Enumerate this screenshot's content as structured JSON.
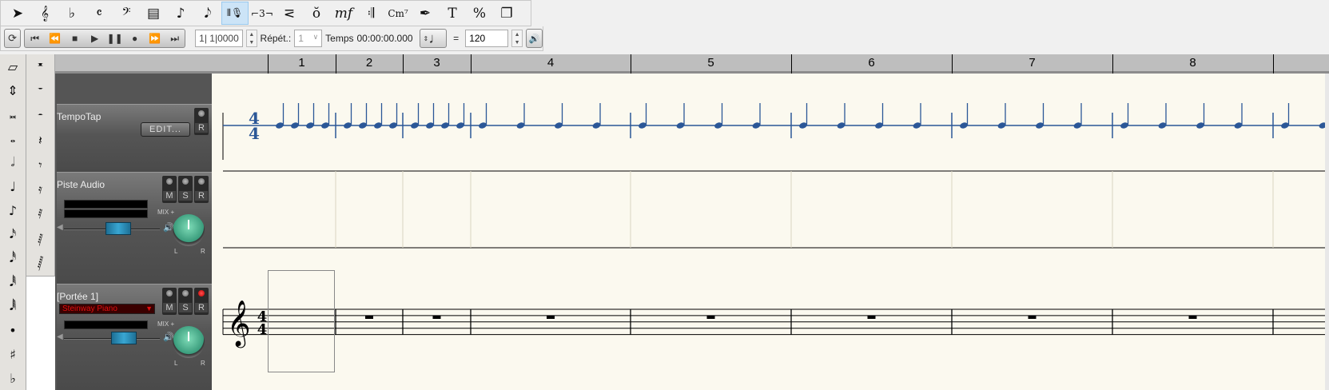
{
  "toolbar1": {
    "tools": [
      {
        "name": "select-arrow",
        "glyph": "➤"
      },
      {
        "name": "treble-staff",
        "glyph": "𝄞"
      },
      {
        "name": "key-signature",
        "glyph": "♭"
      },
      {
        "name": "time-signature",
        "glyph": "𝄴"
      },
      {
        "name": "bass-clef",
        "glyph": "𝄢"
      },
      {
        "name": "staff-box",
        "glyph": "▤"
      },
      {
        "name": "eighth-note",
        "glyph": "♪"
      },
      {
        "name": "grace-note",
        "glyph": "𝅘𝅥𝅮"
      },
      {
        "name": "mic-tracker",
        "glyph": "⦀🎙",
        "active": true
      },
      {
        "name": "tuplet",
        "glyph": "⌐3¬"
      },
      {
        "name": "hairpin",
        "glyph": "⋜"
      },
      {
        "name": "accent-note",
        "glyph": "ŏ"
      },
      {
        "name": "dynamics",
        "glyph": "mf"
      },
      {
        "name": "repeat-barline",
        "glyph": "𝄇"
      },
      {
        "name": "chord-symbol",
        "glyph": "Cm⁷"
      },
      {
        "name": "ink-pen",
        "glyph": "✒"
      },
      {
        "name": "text",
        "glyph": "T"
      },
      {
        "name": "percent",
        "glyph": "%"
      },
      {
        "name": "pages",
        "glyph": "❐"
      }
    ]
  },
  "toolbar2": {
    "loop_glyph": "⟳",
    "transport": [
      {
        "name": "go-start",
        "glyph": "⏮"
      },
      {
        "name": "rewind",
        "glyph": "⏪"
      },
      {
        "name": "stop",
        "glyph": "■"
      },
      {
        "name": "play",
        "glyph": "▶"
      },
      {
        "name": "pause",
        "glyph": "❚❚"
      },
      {
        "name": "record",
        "glyph": "●"
      },
      {
        "name": "fast-forward",
        "glyph": "⏩"
      },
      {
        "name": "go-end",
        "glyph": "⏭"
      }
    ],
    "position": "1| 1|0000",
    "repeat_label": "Répét.:",
    "repeat_value": "1",
    "time_label": "Temps",
    "time_value": "00:00:00.000",
    "note_glyph": "♩",
    "equals": "=",
    "tempo": "120",
    "metronome_glyph": "🔊"
  },
  "palette_notes": [
    "▱",
    "⇕",
    "𝅜",
    "𝅝",
    "𝅗𝅥",
    "♩",
    "♪",
    "𝅘𝅥𝅯",
    "𝅘𝅥𝅰",
    "𝅘𝅥𝅱",
    "𝅘𝅥𝅲",
    "•",
    "♯",
    "♭"
  ],
  "palette_rests": [
    "𝄺",
    "𝄻",
    "𝄼",
    "𝄽",
    "𝄾",
    "𝄿",
    "𝅀",
    "𝅁",
    "𝅂"
  ],
  "ruler": {
    "measures": [
      "1",
      "2",
      "3",
      "4",
      "5",
      "6",
      "7",
      "8"
    ]
  },
  "tracks": {
    "tempo": {
      "name": "TempoTap",
      "edit": "EDIT...",
      "r": "R"
    },
    "audio": {
      "name": "Piste Audio",
      "m": "M",
      "s": "S",
      "r": "R",
      "mix": "MIX +",
      "l": "L",
      "rr": "R"
    },
    "staff": {
      "name": "[Portée 1]",
      "instrument": "Steinway Piano",
      "m": "M",
      "s": "S",
      "r": "R",
      "mix": "MIX +",
      "l": "L",
      "rr": "R",
      "record_armed": true
    }
  },
  "score": {
    "time_signature": "4/4",
    "clef": "treble",
    "tempo_notes_per_measure": 4,
    "colors": {
      "tempo": "#2b5797",
      "paper": "#fbf9ef"
    }
  }
}
